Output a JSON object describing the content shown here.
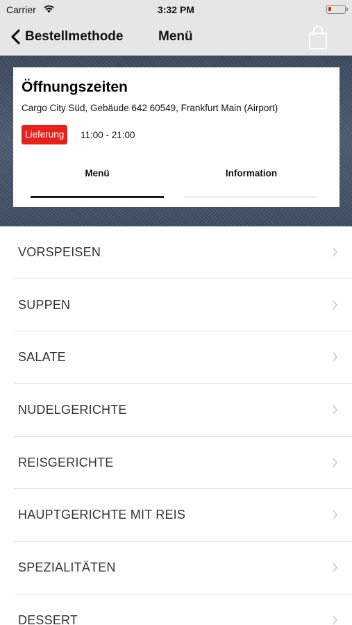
{
  "status_bar": {
    "carrier": "Carrier",
    "time": "3:32 PM"
  },
  "nav": {
    "back_label": "Bestellmethode",
    "title": "Menü",
    "cart_icon": "shopping-bag-icon"
  },
  "info_card": {
    "title": "Öffnungszeiten",
    "address": "Cargo City Süd, Gebäude 642 60549, Frankfurt Main (Airport)",
    "badge": "Lieferung",
    "hours": "11:00 - 21:00",
    "tabs": [
      {
        "label": "Menü",
        "active": true
      },
      {
        "label": "Information",
        "active": false
      }
    ]
  },
  "categories": [
    {
      "label": "VORSPEISEN"
    },
    {
      "label": "SUPPEN"
    },
    {
      "label": "SALATE"
    },
    {
      "label": "NUDELGERICHTE"
    },
    {
      "label": "REISGERICHTE"
    },
    {
      "label": "HAUPTGERICHTE MIT REIS"
    },
    {
      "label": "SPEZIALITÄTEN"
    },
    {
      "label": "DESSERT"
    }
  ],
  "colors": {
    "accent_red": "#e8201c",
    "bar_bg": "#e6e6e6",
    "denim": "#4c5e74"
  }
}
